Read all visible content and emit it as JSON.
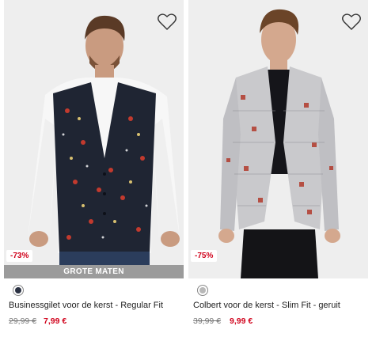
{
  "products": [
    {
      "title": "Businessgilet voor de kerst - Regular Fit",
      "discount": "-73%",
      "badge": "GROTE MATEN",
      "price_old": "29,99 €",
      "price_new": "7,99 €",
      "swatch_color": "#2a3142",
      "image": "man-in-black-christmas-print-vest",
      "favorite_icon": "heart-outline-icon"
    },
    {
      "title": "Colbert voor de kerst - Slim Fit - geruit",
      "discount": "-75%",
      "badge": "",
      "price_old": "39,99 €",
      "price_new": "9,99 €",
      "swatch_color": "#b8b8b8",
      "image": "man-in-grey-plaid-christmas-blazer",
      "favorite_icon": "heart-outline-icon"
    }
  ],
  "colors": {
    "sale_red": "#d0021b",
    "badge_grey": "#9b9b9b",
    "photo_bg": "#eeeeee"
  }
}
